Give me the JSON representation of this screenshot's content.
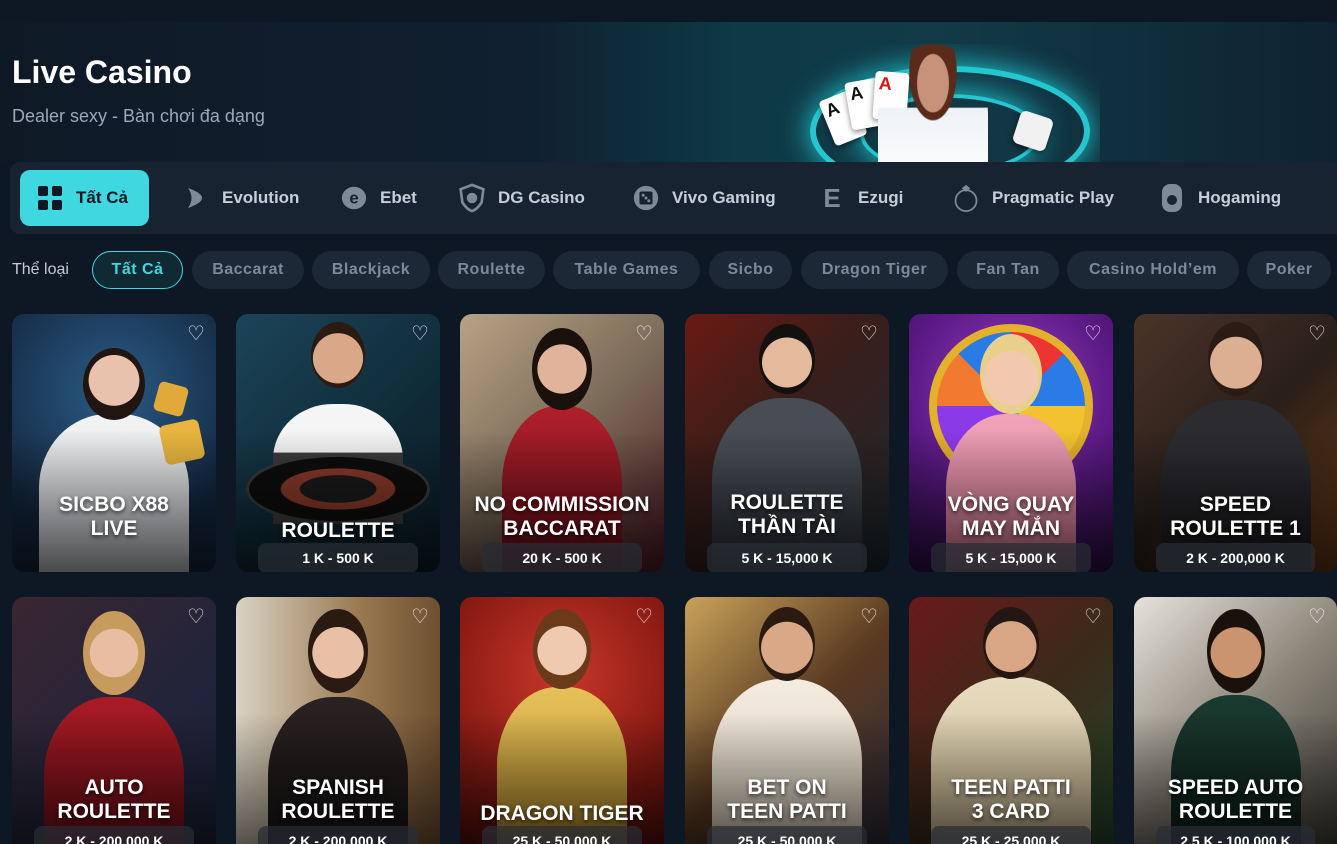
{
  "header": {
    "title": "Live Casino",
    "subtitle": "Dealer sexy - Bàn chơi đa dạng"
  },
  "providers": [
    {
      "label": "Tất Cả",
      "icon": "grid-icon",
      "active": true
    },
    {
      "label": "Evolution",
      "icon": "evolution-logo-icon"
    },
    {
      "label": "Ebet",
      "icon": "ebet-logo-icon"
    },
    {
      "label": "DG Casino",
      "icon": "dg-casino-logo-icon"
    },
    {
      "label": "Vivo Gaming",
      "icon": "vivo-gaming-logo-icon"
    },
    {
      "label": "Ezugi",
      "icon": "ezugi-logo-icon"
    },
    {
      "label": "Pragmatic Play",
      "icon": "pragmatic-play-logo-icon"
    },
    {
      "label": "Hogaming",
      "icon": "hogaming-logo-icon"
    }
  ],
  "categories": {
    "label": "Thể loại",
    "items": [
      "Tất Cả",
      "Baccarat",
      "Blackjack",
      "Roulette",
      "Table Games",
      "Sicbo",
      "Dragon Tiger",
      "Fan Tan",
      "Casino Hold’em",
      "Poker"
    ]
  },
  "games": [
    {
      "title_1": "SICBO X88",
      "title_2": "LIVE",
      "range": ""
    },
    {
      "title_1": "ROULETTE",
      "title_2": "",
      "range": "1 K - 500 K"
    },
    {
      "title_1": "NO COMMISSION",
      "title_2": "BACCARAT",
      "range": "20 K - 500 K"
    },
    {
      "title_1": "ROULETTE",
      "title_2": "THẦN TÀI",
      "range": "5 K - 15,000 K"
    },
    {
      "title_1": "VÒNG QUAY",
      "title_2": "MAY MẮN",
      "range": "5 K - 15,000 K"
    },
    {
      "title_1": "SPEED",
      "title_2": "ROULETTE 1",
      "range": "2 K - 200,000 K"
    },
    {
      "title_1": "AUTO",
      "title_2": "ROULETTE",
      "range": "2 K - 200,000 K"
    },
    {
      "title_1": "SPANISH",
      "title_2": "ROULETTE",
      "range": "2 K - 200,000 K"
    },
    {
      "title_1": "DRAGON TIGER",
      "title_2": "",
      "range": "25 K - 50,000 K"
    },
    {
      "title_1": "BET ON",
      "title_2": "TEEN PATTI",
      "range": "25 K - 50,000 K"
    },
    {
      "title_1": "TEEN PATTI",
      "title_2": "3 CARD",
      "range": "25 K - 25,000 K"
    },
    {
      "title_1": "SPEED AUTO",
      "title_2": "ROULETTE",
      "range": "2.5 K - 100,000 K"
    }
  ],
  "banner_cards": [
    "A",
    "A",
    "A"
  ],
  "colors": {
    "accent": "#3fd7e0",
    "background": "#0e1724",
    "panel": "#182331"
  }
}
